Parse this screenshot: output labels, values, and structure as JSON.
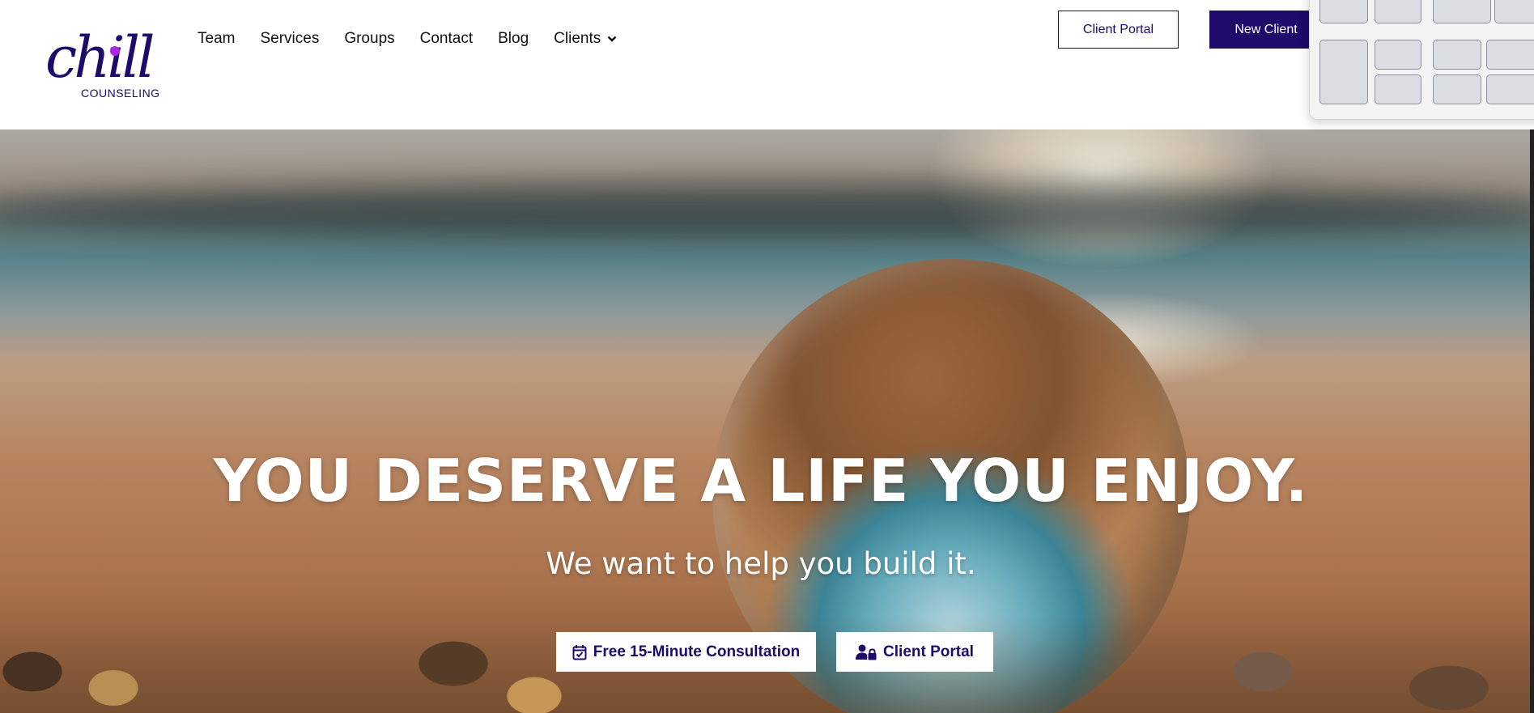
{
  "brand": {
    "logo_main": "chill",
    "logo_sub": "COUNSELING"
  },
  "nav": {
    "items": [
      "Team",
      "Services",
      "Groups",
      "Contact",
      "Blog",
      "Clients"
    ]
  },
  "header": {
    "client_portal_label": "Client Portal",
    "new_client_label": "New Client"
  },
  "hero": {
    "title": "YOU DESERVE A LIFE YOU ENJOY.",
    "subtitle": "We want to help you build it.",
    "consult_label": "Free 15-Minute Consultation",
    "portal_label": "Client Portal"
  },
  "colors": {
    "brand": "#1d0a6b",
    "accent": "#b224e6"
  }
}
